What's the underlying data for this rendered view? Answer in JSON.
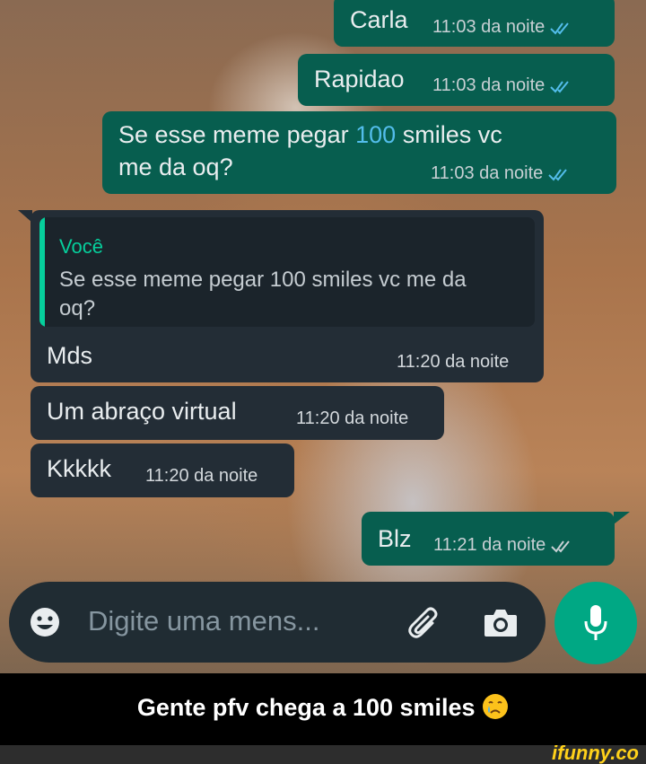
{
  "messages": [
    {
      "text": "Carla",
      "time": "11:03 da noite"
    },
    {
      "text": "Rapidao",
      "time": "11:03 da noite"
    },
    {
      "text_before": "Se esse meme pegar ",
      "number": "100",
      "text_after": " smiles vc",
      "line2": "me da oq?",
      "time": "11:03 da noite"
    },
    {
      "quote_author": "Você",
      "quote_text": "Se esse meme pegar 100 smiles vc me da oq?",
      "text": "Mds",
      "time": "11:20 da noite"
    },
    {
      "text": "Um abraço virtual",
      "time": "11:20 da noite"
    },
    {
      "text": "Kkkkk",
      "time": "11:20 da noite"
    },
    {
      "text": "Blz",
      "time": "11:21 da noite"
    }
  ],
  "input": {
    "placeholder": "Digite uma mens..."
  },
  "caption": "Gente pfv chega a 100 smiles",
  "brand": "ifunny.co",
  "colors": {
    "outgoing": "#075e4f",
    "incoming": "#232d36",
    "accent": "#00a884",
    "ticks": "#53bdeb"
  },
  "icons": [
    "read-ticks-icon",
    "emoji-icon",
    "attach-icon",
    "camera-icon",
    "mic-icon",
    "crying-emoji-icon"
  ]
}
